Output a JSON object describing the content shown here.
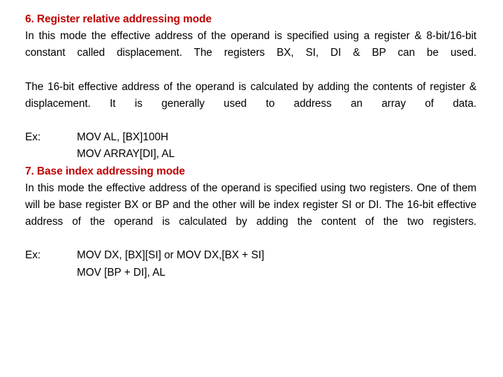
{
  "slide": {
    "background_color": "#ffffff",
    "heading_color": "#C00000",
    "body_color": "#000000",
    "sections": [
      {
        "heading": "6. Register relative addressing mode",
        "paragraphs": [
          "In this mode the effective address of the operand is specified using a register & 8-bit/16-bit constant called displacement. The registers BX, SI, DI & BP can be used.",
          "The 16-bit effective address of the operand is calculated by adding the contents of register & displacement. It is generally used to address an array of data."
        ],
        "examples": {
          "label": "Ex:",
          "lines": [
            "MOV AL, [BX]100H",
            "MOV ARRAY[DI], AL"
          ]
        }
      },
      {
        "heading": "7. Base index addressing mode",
        "paragraphs": [
          "In this mode the effective address of the operand is specified using two registers. One of them will be base register BX or BP and the other will be index register SI or DI. The 16-bit effective address of the operand is calculated by adding the content of the two registers."
        ],
        "examples": {
          "label": "Ex:",
          "lines": [
            "MOV DX, [BX][SI] or MOV DX,[BX + SI]",
            "MOV [BP + DI], AL"
          ]
        }
      }
    ]
  }
}
